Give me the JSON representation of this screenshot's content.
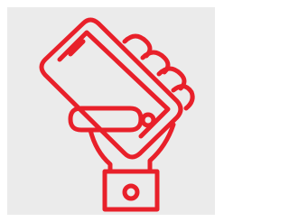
{
  "icon": {
    "name": "hand-holding-smartphone-icon",
    "stroke_color": "#e8202a",
    "background_color": "#ebebeb"
  }
}
